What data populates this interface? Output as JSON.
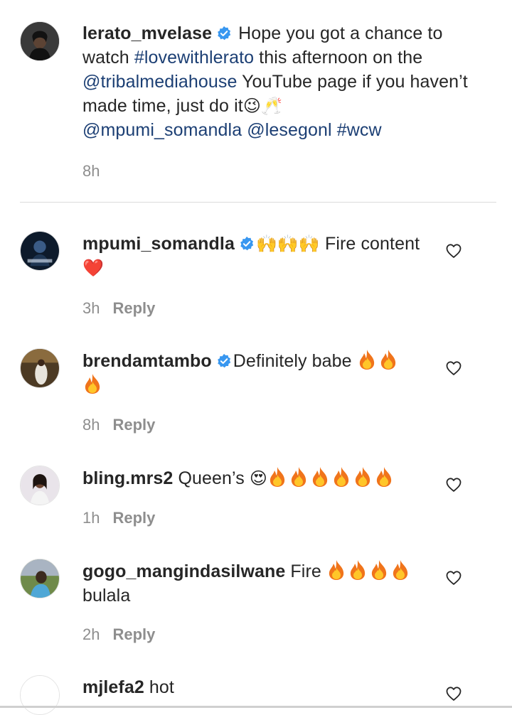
{
  "post": {
    "username": "lerato_mvelase",
    "verified": true,
    "text_1": "Hope you got a chance to watch ",
    "hashtag_1": "#lovewithlerato",
    "text_2": " this afternoon on the ",
    "mention_1": "@tribalmediahouse",
    "text_3": " YouTube page if you haven’t made time, just do it",
    "mention_2": "@mpumi_somandla",
    "mention_3": "@lesegonl",
    "hashtag_2": "#wcw",
    "emoji_wink": "😉",
    "emoji_cheers": "🥂",
    "time": "8h"
  },
  "comments": [
    {
      "username": "mpumi_somandla",
      "verified": true,
      "text": "Fire content",
      "emoji_hands": "🙌🙌🙌",
      "emoji_heart": "❤️",
      "time": "3h",
      "reply_label": "Reply"
    },
    {
      "username": "brendamtambo",
      "verified": true,
      "text": "Definitely babe",
      "time": "8h",
      "reply_label": "Reply"
    },
    {
      "username": "bling.mrs2",
      "verified": false,
      "text": "Queen’s",
      "emoji_heart_eyes": "😍",
      "time": "1h",
      "reply_label": "Reply"
    },
    {
      "username": "gogo_mangindasilwane",
      "verified": false,
      "text": "Fire",
      "text_2": "bulala",
      "time": "2h",
      "reply_label": "Reply"
    },
    {
      "username": "mjlefa2",
      "verified": false,
      "text": "hot"
    }
  ],
  "icons": {
    "verified": "verified-badge-icon",
    "like": "heart-outline-icon",
    "fire": "fire-icon"
  },
  "colors": {
    "link": "#1c3f74",
    "verified": "#3897f0",
    "meta": "#8e8e8e",
    "text": "#262626"
  }
}
